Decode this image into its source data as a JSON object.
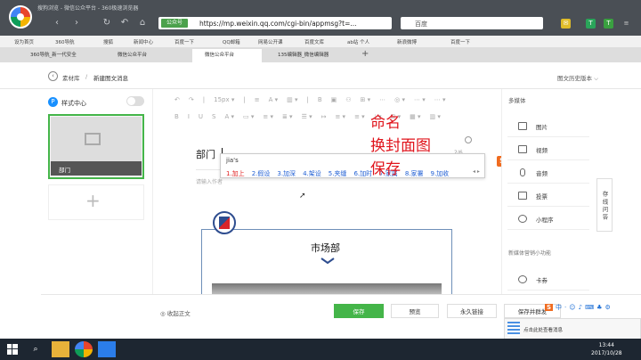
{
  "window": {
    "title": "搜狗浏览 - 微信公众平台 - 360极速浏览器"
  },
  "nav": {
    "back": "‹",
    "forward": "›",
    "reload": "↻",
    "undo": "↶",
    "home": "⌂",
    "star": "☆"
  },
  "address": {
    "ssl_label": "公众号",
    "url": "https://mp.weixin.qq.com/cgi-bin/appmsg?t=...",
    "search_placeholder": "百度"
  },
  "bookmarks": [
    "设为首页",
    "360导航",
    "搜狐",
    "新闻中心",
    "百度一下",
    "QQ邮箱",
    "网易公开课",
    "百度文库",
    "ab站 个人",
    "新浪微博",
    "百度一下"
  ],
  "tabs": [
    {
      "label": "360导航_新一代安全"
    },
    {
      "label": "微信公众平台"
    },
    {
      "label": "微信公众平台"
    },
    {
      "label": "135编辑器_微信编辑器"
    }
  ],
  "page": {
    "crumb_home": "素材库",
    "crumb_sep": "/",
    "crumb_current": "新建图文消息",
    "history": "图文历史版本 ⌵",
    "style_label": "样式中心",
    "card_title": "部门"
  },
  "editor": {
    "toolbar1": [
      "↶",
      "↷",
      "|",
      "15px ▾",
      "|",
      "≡",
      "A ▾",
      "▥ ▾",
      "|",
      "B",
      "▣",
      "⚇",
      "⊞ ▾",
      "⋯",
      "◎ ▾",
      "⋯ ▾",
      "⋯ ▾"
    ],
    "toolbar2": [
      "B",
      "I",
      "U",
      "S",
      "A ▾",
      "▭ ▾",
      "≡ ▾",
      "≣ ▾",
      "☰ ▾",
      "↦",
      "≡ ▾",
      "≡ ▾",
      "⤓ ▾",
      "⊞ ▾",
      "▦ ▾",
      "▥ ▾"
    ],
    "title_value": "部门",
    "author_placeholder": "请输入作者",
    "ime_typed": "jia's",
    "ime_candidates": [
      "1.加上",
      "2.假设",
      "3.加深",
      "4.架设",
      "5.夹缝",
      "6.加时",
      "7.家属",
      "8.家署",
      "9.加收"
    ],
    "count": "2/6",
    "annotation": [
      "命名",
      "换封面图",
      "保存"
    ],
    "article_title": "市场部",
    "sogou": "S"
  },
  "right": {
    "section_label": "多媒体",
    "items": [
      {
        "label": "图片",
        "icon": "image-icon"
      },
      {
        "label": "视频",
        "icon": "video-icon"
      },
      {
        "label": "音频",
        "icon": "audio-icon"
      },
      {
        "label": "投票",
        "icon": "vote-icon"
      },
      {
        "label": "小程序",
        "icon": "miniprogram-icon"
      }
    ],
    "new_feature_label": "新媒体营销小功能",
    "extra_item": {
      "label": "卡券",
      "icon": "coupon-icon"
    },
    "side_tab": "存 线 问 答"
  },
  "actions": {
    "collapse": "◎ 收起正文",
    "save": "保存",
    "preview": "预览",
    "timed": "永久链接",
    "publish": "保存并群发"
  },
  "notification": {
    "text": "点击此处查看消息"
  },
  "taskbar": {
    "time": "13:44",
    "date": "2017/10/28"
  },
  "colors": {
    "accent": "#44b549",
    "annotation": "#e0141c",
    "chrome": "#4a4f55",
    "taskbar": "#1d2631"
  }
}
